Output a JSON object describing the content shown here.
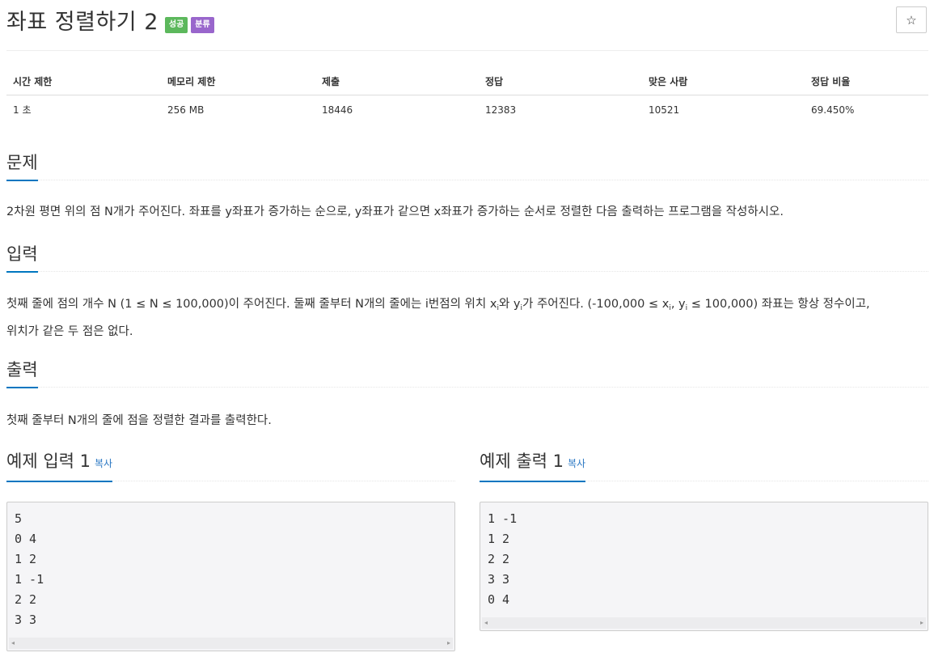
{
  "problem": {
    "title": "좌표 정렬하기 2",
    "badges": {
      "success": "성공",
      "category": "분류"
    },
    "star_icon": "☆"
  },
  "info_table": {
    "headers": [
      "시간 제한",
      "메모리 제한",
      "제출",
      "정답",
      "맞은 사람",
      "정답 비율"
    ],
    "values": [
      "1 초",
      "256 MB",
      "18446",
      "12383",
      "10521",
      "69.450%"
    ]
  },
  "sections": {
    "problem_heading": "문제",
    "problem_text": "2차원 평면 위의 점 N개가 주어진다. 좌표를 y좌표가 증가하는 순으로, y좌표가 같으면 x좌표가 증가하는 순서로 정렬한 다음 출력하는 프로그램을 작성하시오.",
    "input_heading": "입력",
    "input_text_1": "첫째 줄에 점의 개수 N (1 ≤ N ≤ 100,000)이 주어진다. 둘째 줄부터 N개의 줄에는 i번점의 위치 x",
    "input_sub_i": "i",
    "input_text_2": "와 y",
    "input_text_3": "가 주어진다. (-100,000 ≤ x",
    "input_text_4": ", y",
    "input_text_5": " ≤ 100,000) 좌표는 항상 정수이고,",
    "input_text_6": "위치가 같은 두 점은 없다.",
    "output_heading": "출력",
    "output_text": "첫째 줄부터 N개의 줄에 점을 정렬한 결과를 출력한다."
  },
  "examples": {
    "input_heading": "예제 입력 1",
    "output_heading": "예제 출력 1",
    "copy_label": "복사",
    "input_code": "5\n0 4\n1 2\n1 -1\n2 2\n3 3",
    "output_code": "1 -1\n1 2\n2 2\n3 3\n0 4",
    "scroll_left": "◂",
    "scroll_right": "▸"
  }
}
